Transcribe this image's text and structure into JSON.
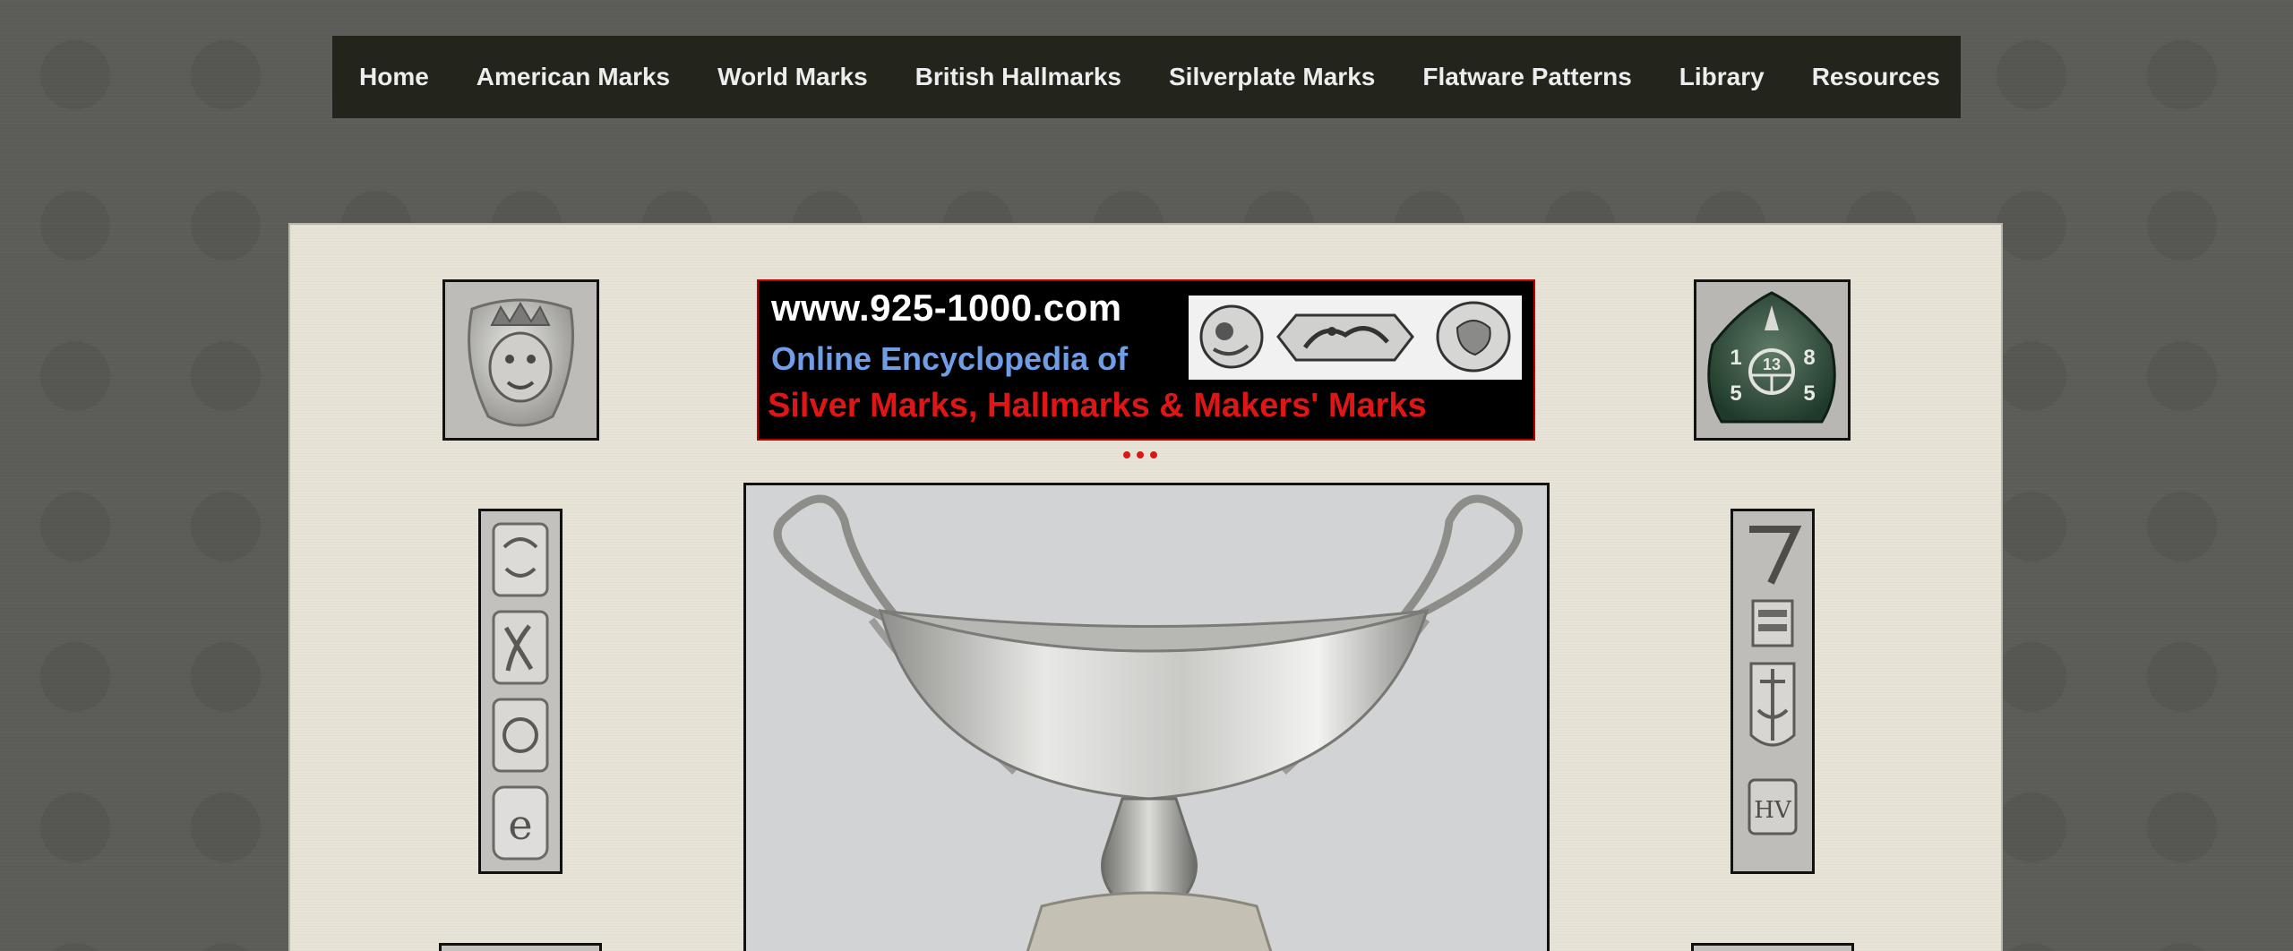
{
  "nav": {
    "items": [
      {
        "label": "Home"
      },
      {
        "label": "American Marks"
      },
      {
        "label": "World Marks"
      },
      {
        "label": "British Hallmarks"
      },
      {
        "label": "Silverplate Marks"
      },
      {
        "label": "Flatware Patterns"
      },
      {
        "label": "Library"
      },
      {
        "label": "Resources"
      }
    ]
  },
  "banner": {
    "url": "www.925-1000.com",
    "subtitle": "Online Encyclopedia of",
    "title": "Silver Marks, Hallmarks & Makers' Marks"
  },
  "marks": {
    "right_shield": [
      "1",
      "13",
      "8",
      "5",
      "5"
    ]
  },
  "colors": {
    "nav_bg": "#23241c",
    "panel_bg": "#e7e3d6",
    "page_bg": "#5b5c57",
    "banner_red": "#e01515",
    "banner_blue": "#6f9ee6"
  }
}
